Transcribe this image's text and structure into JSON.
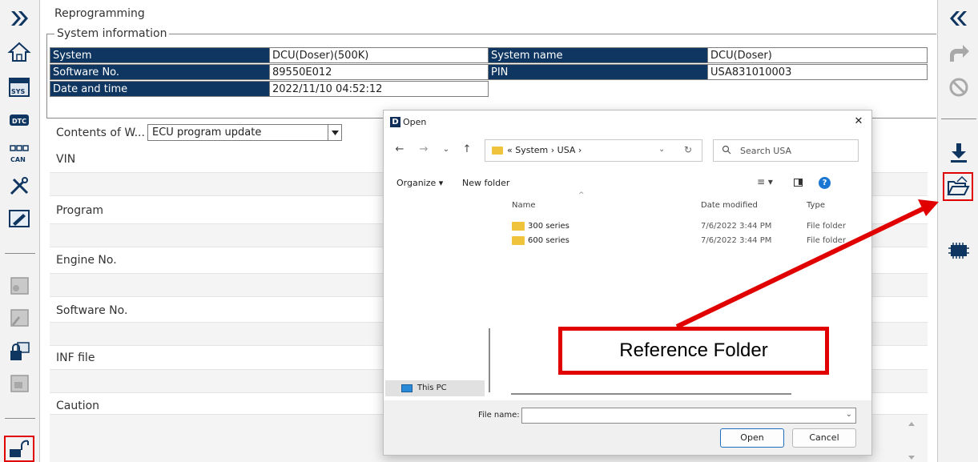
{
  "page": {
    "title": "Reprogramming"
  },
  "system_info": {
    "legend": "System information",
    "rows": [
      {
        "label": "System",
        "value": "DCU(Doser)(500K)",
        "label2": "System name",
        "value2": "DCU(Doser)"
      },
      {
        "label": "Software No.",
        "value": "89550E012",
        "label2": "PIN",
        "value2": "USA831010003"
      },
      {
        "label": "Date and time",
        "value": "2022/11/10 04:52:12"
      }
    ]
  },
  "contents": {
    "label": "Contents of W...",
    "selected": "ECU program update"
  },
  "fields": {
    "vin": "VIN",
    "program": "Program",
    "engine_no": "Engine No.",
    "software_no": "Software No.",
    "inf_file": "INF file",
    "caution": "Caution"
  },
  "dialog": {
    "title": "Open",
    "logo": "D",
    "close": "✕",
    "address": "« System › USA ›",
    "search_placeholder": "Search USA",
    "organize": "Organize ▾",
    "new_folder": "New folder",
    "columns": {
      "name": "Name",
      "date": "Date modified",
      "type": "Type"
    },
    "files": [
      {
        "name": "300 series",
        "date": "7/6/2022 3:44 PM",
        "type": "File folder"
      },
      {
        "name": "600 series",
        "date": "7/6/2022 3:44 PM",
        "type": "File folder"
      }
    ],
    "nav_this_pc": "This PC",
    "file_name_label": "File name:",
    "file_name_value": "",
    "open_button": "Open",
    "cancel_button": "Cancel"
  },
  "callout": {
    "text": "Reference Folder",
    "color": "#e00000"
  },
  "colors": {
    "header_navy": "#0f3561",
    "highlight_red": "#e00000"
  }
}
